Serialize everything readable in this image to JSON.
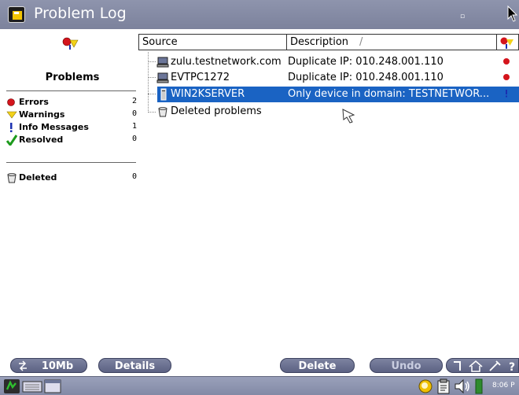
{
  "window": {
    "title": "Problem Log"
  },
  "left_panel": {
    "title": "Problems",
    "categories": [
      {
        "label": "Errors",
        "count": "2",
        "icon": "red-dot-icon"
      },
      {
        "label": "Warnings",
        "count": "0",
        "icon": "yellow-triangle-icon"
      },
      {
        "label": "Info Messages",
        "count": "1",
        "icon": "exclamation-icon"
      },
      {
        "label": "Resolved",
        "count": "0",
        "icon": "green-check-icon"
      }
    ],
    "deleted": {
      "label": "Deleted",
      "count": "0",
      "icon": "trash-icon"
    }
  },
  "table": {
    "columns": {
      "source": "Source",
      "description": "Description"
    },
    "rows": [
      {
        "source": "zulu.testnetwork.com",
        "description": "Duplicate IP: 010.248.001.110",
        "icon": "computer-icon",
        "status": "error",
        "selected": false
      },
      {
        "source": "EVTPC1272",
        "description": "Duplicate IP: 010.248.001.110",
        "icon": "computer-icon",
        "status": "error",
        "selected": false
      },
      {
        "source": "WIN2KSERVER",
        "description": "Only device in domain: TESTNETWOR...",
        "icon": "server-icon",
        "status": "info",
        "selected": true
      }
    ],
    "deleted_node": {
      "label": "Deleted problems",
      "icon": "trash-icon"
    }
  },
  "buttons": {
    "memory": "10Mb",
    "details": "Details",
    "delete": "Delete",
    "undo": "Undo"
  },
  "taskbar": {
    "clock": "8:06 P"
  },
  "colors": {
    "title_bar": "#8388a3",
    "selection": "#1a63c3",
    "button": "#6a7090",
    "error": "#d4141c",
    "warning": "#f3d21a",
    "resolved": "#1c9a1c"
  }
}
